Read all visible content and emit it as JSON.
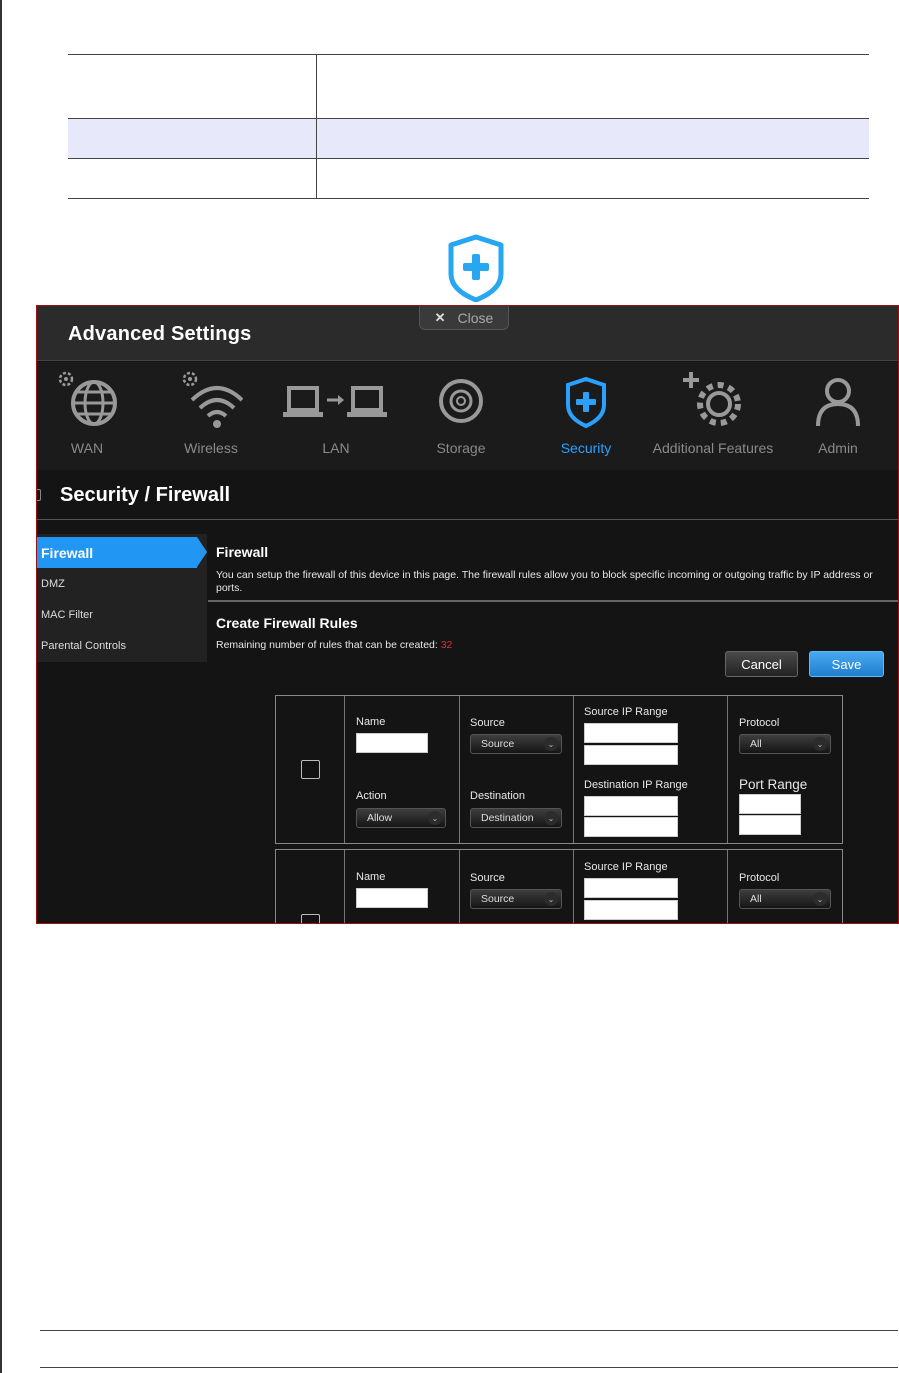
{
  "doc_table": {
    "rows": [
      [
        "",
        ""
      ],
      [
        "",
        ""
      ],
      [
        "",
        ""
      ]
    ]
  },
  "window": {
    "title": "Advanced Settings",
    "close_label": "Close"
  },
  "nav": [
    {
      "label": "WAN",
      "icon": "globe-gear-icon"
    },
    {
      "label": "Wireless",
      "icon": "wifi-gear-icon"
    },
    {
      "label": "LAN",
      "icon": "lan-computers-icon"
    },
    {
      "label": "Storage",
      "icon": "disc-icon"
    },
    {
      "label": "Security",
      "icon": "shield-plus-icon",
      "active": true
    },
    {
      "label": "Additional Features",
      "icon": "gear-plus-icon"
    },
    {
      "label": "Admin",
      "icon": "user-icon"
    }
  ],
  "section_title": "Security / Firewall",
  "sidebar": [
    {
      "label": "Firewall",
      "active": true
    },
    {
      "label": "DMZ"
    },
    {
      "label": "MAC Filter"
    },
    {
      "label": "Parental Controls"
    }
  ],
  "firewall": {
    "heading": "Firewall",
    "description": "You can setup the firewall of this device in this page. The firewall rules allow you to block specific incoming or outgoing traffic by IP address or ports."
  },
  "create_rules": {
    "heading": "Create Firewall Rules",
    "remaining_label": "Remaining number of rules that can be created: ",
    "remaining_count": "32"
  },
  "buttons": {
    "cancel": "Cancel",
    "save": "Save"
  },
  "rules": [
    {
      "name_label": "Name",
      "name_value": "",
      "source_label": "Source",
      "source_value": "Source",
      "source_ip_label": "Source IP Range",
      "protocol_label": "Protocol",
      "protocol_value": "All",
      "action_label": "Action",
      "action_value": "Allow",
      "destination_label": "Destination",
      "destination_value": "Destination",
      "dest_ip_label": "Destination IP Range",
      "port_range_label": "Port Range"
    },
    {
      "name_label": "Name",
      "name_value": "",
      "source_label": "Source",
      "source_value": "Source",
      "source_ip_label": "Source IP Range",
      "protocol_label": "Protocol",
      "protocol_value": "All"
    }
  ],
  "colors": {
    "accent": "#2196f3",
    "remaining": "#e03030",
    "frame_border": "#a01010"
  }
}
